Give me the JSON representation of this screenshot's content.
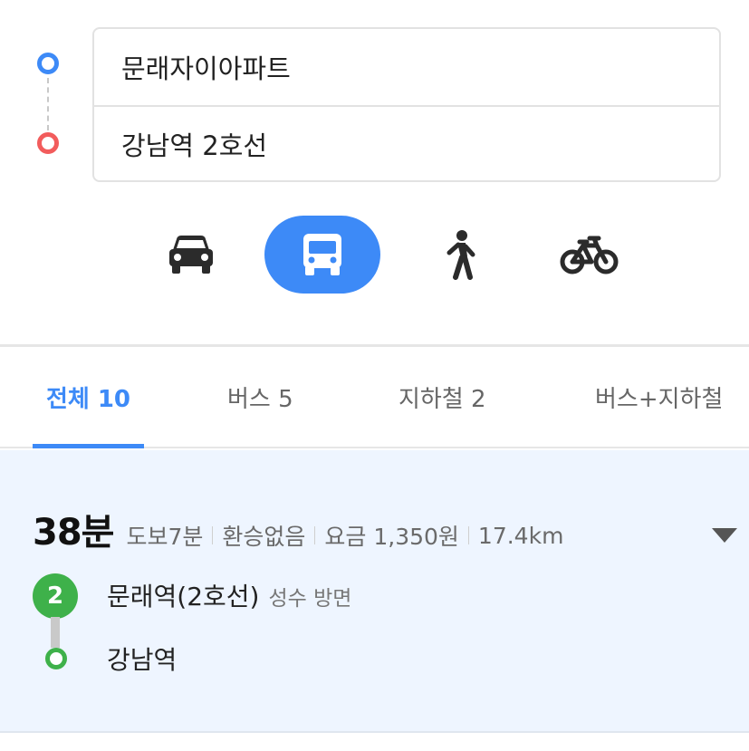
{
  "search": {
    "origin": "문래자이아파트",
    "destination": "강남역 2호선"
  },
  "modes": [
    {
      "name": "car",
      "icon": "car-icon",
      "selected": false
    },
    {
      "name": "bus",
      "icon": "bus-icon",
      "selected": true
    },
    {
      "name": "walk",
      "icon": "walk-icon",
      "selected": false
    },
    {
      "name": "bike",
      "icon": "bicycle-icon",
      "selected": false
    }
  ],
  "tabs": [
    {
      "label": "전체 10",
      "active": true
    },
    {
      "label": "버스 5",
      "active": false
    },
    {
      "label": "지하철 2",
      "active": false
    },
    {
      "label": "버스+지하철",
      "active": false
    }
  ],
  "result": {
    "duration": "38분",
    "walk": "도보7분",
    "transfer": "환승없음",
    "fare": "요금 1,350원",
    "distance": "17.4km",
    "line_number": "2",
    "line_color": "#3eb14a",
    "board_stop": "문래역(2호선)",
    "direction": "성수 방면",
    "alight_stop": "강남역"
  },
  "colors": {
    "accent": "#3d8af7",
    "origin_dot": "#3d8af7",
    "destination_dot": "#f25c5c",
    "result_bg": "#eef5ff"
  }
}
